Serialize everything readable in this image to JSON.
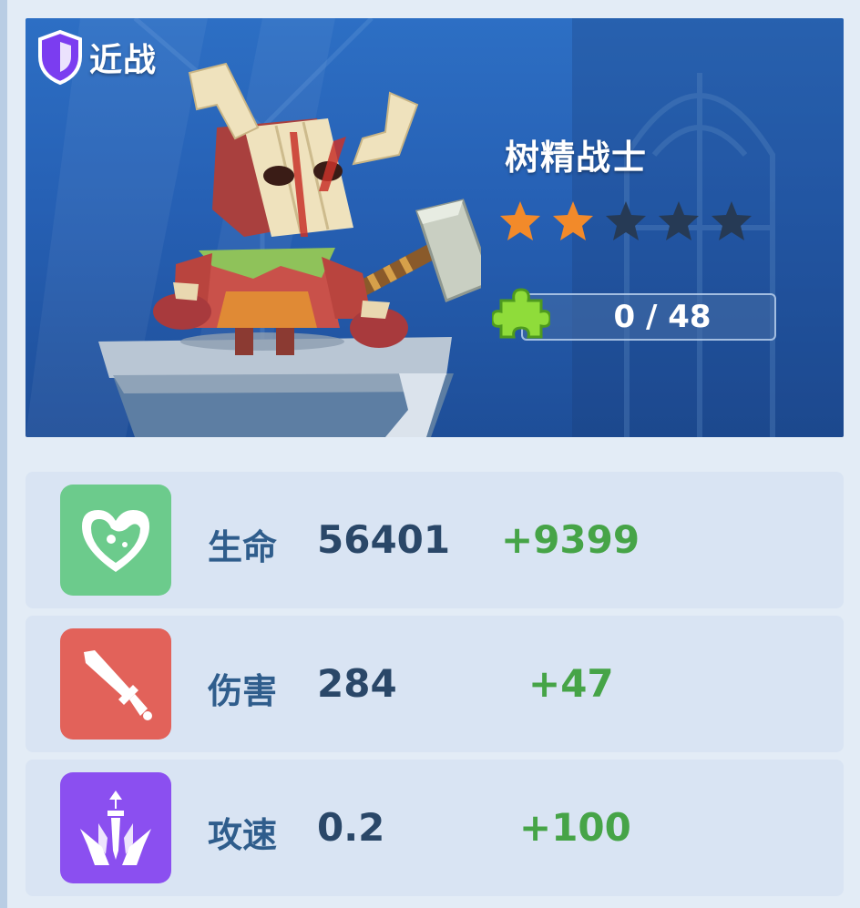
{
  "unit": {
    "type_label": "近战",
    "name": "树精战士",
    "stars_filled": 2,
    "stars_total": 5,
    "shards_text": "0 / 48",
    "shards_current": 0,
    "shards_required": 48
  },
  "stats": [
    {
      "label": "生命",
      "value": "56401",
      "bonus": "+9399",
      "icon": "heart-potion-icon",
      "color": "#6ccb8c"
    },
    {
      "label": "伤害",
      "value": "284",
      "bonus": "+47",
      "icon": "sword-icon",
      "color": "#e2625a"
    },
    {
      "label": "攻速",
      "value": "0.2",
      "bonus": "+100",
      "icon": "attack-speed-icon",
      "color": "#8b4ff0"
    }
  ],
  "colors": {
    "star_filled": "#f28a2a",
    "star_empty": "#263a55",
    "bonus_text": "#46a447",
    "label_text": "#2f5d8c",
    "value_text": "#2a4768",
    "badge_shield": "#7b3df0"
  }
}
